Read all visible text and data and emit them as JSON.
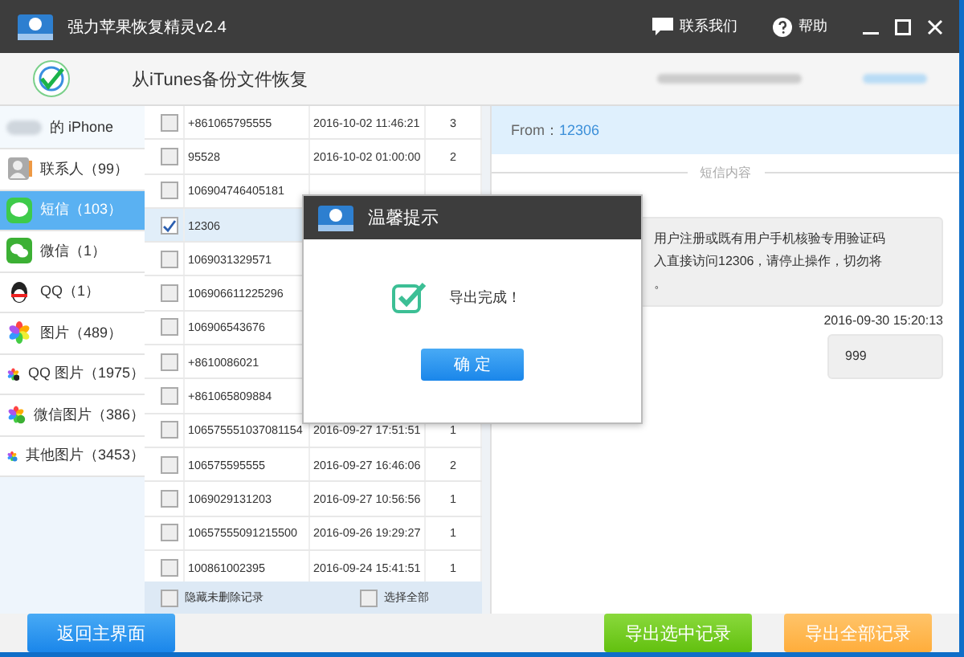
{
  "window": {
    "title": "强力苹果恢复精灵v2.4",
    "links": [
      "联系我们",
      "帮助"
    ]
  },
  "header": {
    "title": "从iTunes备份文件恢复"
  },
  "sidebar": {
    "items": [
      {
        "kind": "device",
        "label": "的 iPhone",
        "selected": false
      },
      {
        "kind": "contacts",
        "label": "联系人（99）",
        "selected": false
      },
      {
        "kind": "sms",
        "label": "短信（103）",
        "selected": true
      },
      {
        "kind": "wechat",
        "label": "微信（1）",
        "selected": false
      },
      {
        "kind": "qq",
        "label": "QQ（1）",
        "selected": false
      },
      {
        "kind": "photos",
        "label": "图片（489）",
        "selected": false
      },
      {
        "kind": "qq_photos",
        "label": "QQ 图片（1975）",
        "selected": false
      },
      {
        "kind": "wechat_photos",
        "label": "微信图片（386）",
        "selected": false
      },
      {
        "kind": "other_photos",
        "label": "其他图片（3453）",
        "selected": false
      }
    ]
  },
  "table": {
    "rows": [
      {
        "checked": false,
        "selected": false,
        "number": "+861065795555",
        "date": "2016-10-02 11:46:21",
        "count": "3"
      },
      {
        "checked": false,
        "selected": false,
        "number": "95528",
        "date": "2016-10-02 01:00:00",
        "count": "2"
      },
      {
        "checked": false,
        "selected": false,
        "number": "106904746405181"
      },
      {
        "checked": true,
        "selected": true,
        "number": "12306"
      },
      {
        "checked": false,
        "selected": false,
        "number": "1069031329571"
      },
      {
        "checked": false,
        "selected": false,
        "number": "106906611225296"
      },
      {
        "checked": false,
        "selected": false,
        "number": "106906543676"
      },
      {
        "checked": false,
        "selected": false,
        "number": "+8610086021"
      },
      {
        "checked": false,
        "selected": false,
        "number": "+861065809884"
      },
      {
        "checked": false,
        "selected": false,
        "number": "106575551037081154",
        "date": "2016-09-27 17:51:51",
        "count": "1"
      },
      {
        "checked": false,
        "selected": false,
        "number": "106575595555",
        "date": "2016-09-27 16:46:06",
        "count": "2"
      },
      {
        "checked": false,
        "selected": false,
        "number": "1069029131203",
        "date": "2016-09-27 10:56:56",
        "count": "1"
      },
      {
        "checked": false,
        "selected": false,
        "number": "10657555091215500",
        "date": "2016-09-26 19:29:27",
        "count": "1"
      },
      {
        "checked": false,
        "selected": false,
        "number": "100861002395",
        "date": "2016-09-24 15:41:51",
        "count": "1"
      }
    ],
    "footer": [
      {
        "label": "隐藏未删除记录",
        "checked": false
      },
      {
        "label": "选择全部",
        "checked": false
      }
    ]
  },
  "detail": {
    "from_label": "From：",
    "from_value": "12306",
    "divider": "短信内容",
    "messages": [
      {
        "kind": "received",
        "lines": [
          "用户注册或既有用户手机核验专用验证码",
          "入直接访问12306，请停止操作，切勿将",
          "。"
        ]
      },
      {
        "kind": "sent",
        "time": "2016-09-30 15:20:13",
        "lines": [
          "999"
        ]
      }
    ]
  },
  "buttons": {
    "back": "返回主界面",
    "export_selected": "导出选中记录",
    "export_all": "导出全部记录"
  },
  "dialog": {
    "title": "温馨提示",
    "message": "导出完成！",
    "ok": "确 定"
  }
}
